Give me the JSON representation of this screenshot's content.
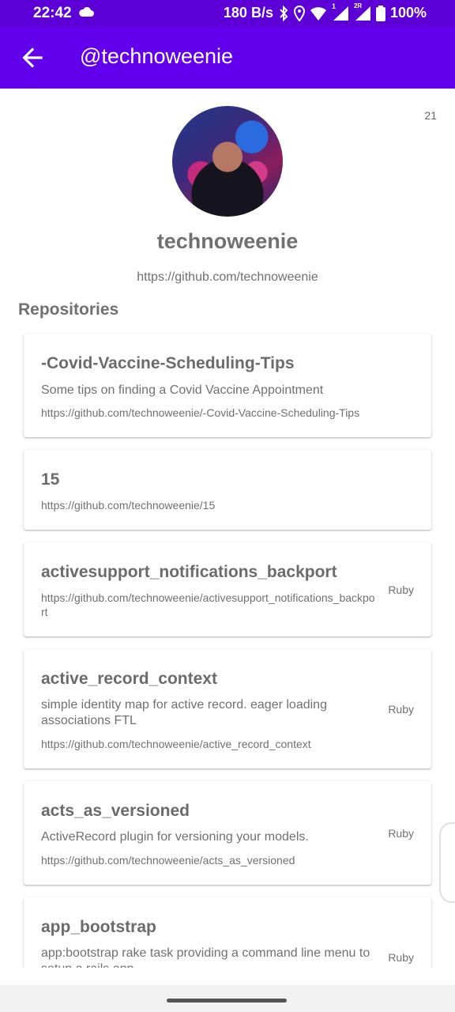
{
  "status_bar": {
    "time": "22:42",
    "network_speed": "180 B/s",
    "sim1_badge": "1",
    "sim2_badge": "2R",
    "battery": "100%",
    "icons": [
      "cloud-icon",
      "bluetooth-icon",
      "location-icon",
      "wifi-icon",
      "signal-icon",
      "battery-icon"
    ]
  },
  "app_bar": {
    "title": "@technoweenie",
    "back_icon": "arrow-back-icon"
  },
  "profile": {
    "counter": "21",
    "name": "technoweenie",
    "url": "https://github.com/technoweenie"
  },
  "repositories": {
    "title": "Repositories",
    "items": [
      {
        "name": "-Covid-Vaccine-Scheduling-Tips",
        "description": "Some tips on finding a Covid Vaccine Appointment",
        "url": "https://github.com/technoweenie/-Covid-Vaccine-Scheduling-Tips",
        "language": ""
      },
      {
        "name": "15",
        "description": "",
        "url": "https://github.com/technoweenie/15",
        "language": ""
      },
      {
        "name": "activesupport_notifications_backport",
        "description": "",
        "url": "https://github.com/technoweenie/activesupport_notifications_backport",
        "language": "Ruby"
      },
      {
        "name": "active_record_context",
        "description": "simple identity map for active record.  eager loading associations FTL",
        "url": "https://github.com/technoweenie/active_record_context",
        "language": "Ruby"
      },
      {
        "name": "acts_as_versioned",
        "description": "ActiveRecord plugin for versioning your models.",
        "url": "https://github.com/technoweenie/acts_as_versioned",
        "language": "Ruby"
      },
      {
        "name": "app_bootstrap",
        "description": "app:bootstrap rake task providing a command line menu to setup a rails app",
        "url": "",
        "language": "Ruby"
      }
    ]
  },
  "colors": {
    "status_bar": "#5d00d8",
    "app_bar": "#6200ee",
    "text_gray": "#707070"
  }
}
